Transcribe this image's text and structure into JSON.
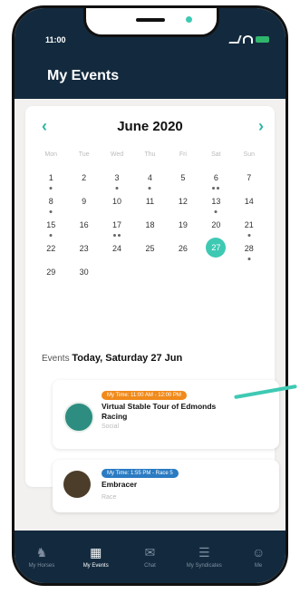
{
  "status": {
    "time": "11:00"
  },
  "header": {
    "title": "My Events"
  },
  "calendar": {
    "month": "June 2020",
    "weekdays": [
      "Mon",
      "Tue",
      "Wed",
      "Thu",
      "Fri",
      "Sat",
      "Sun"
    ],
    "days": [
      {
        "n": "1",
        "dots": 1
      },
      {
        "n": "2",
        "dots": 0
      },
      {
        "n": "3",
        "dots": 1
      },
      {
        "n": "4",
        "dots": 1
      },
      {
        "n": "5",
        "dots": 0
      },
      {
        "n": "6",
        "dots": 2
      },
      {
        "n": "7",
        "dots": 0
      },
      {
        "n": "8",
        "dots": 1
      },
      {
        "n": "9",
        "dots": 0
      },
      {
        "n": "10",
        "dots": 0
      },
      {
        "n": "11",
        "dots": 0
      },
      {
        "n": "12",
        "dots": 0
      },
      {
        "n": "13",
        "dots": 1
      },
      {
        "n": "14",
        "dots": 0
      },
      {
        "n": "15",
        "dots": 1
      },
      {
        "n": "16",
        "dots": 0
      },
      {
        "n": "17",
        "dots": 2
      },
      {
        "n": "18",
        "dots": 0
      },
      {
        "n": "19",
        "dots": 0
      },
      {
        "n": "20",
        "dots": 0
      },
      {
        "n": "21",
        "dots": 1
      },
      {
        "n": "22",
        "dots": 0
      },
      {
        "n": "23",
        "dots": 0
      },
      {
        "n": "24",
        "dots": 0
      },
      {
        "n": "25",
        "dots": 0
      },
      {
        "n": "26",
        "dots": 0
      },
      {
        "n": "27",
        "dots": 0,
        "selected": true
      },
      {
        "n": "28",
        "dots": 1
      },
      {
        "n": "29",
        "dots": 0
      },
      {
        "n": "30",
        "dots": 0
      }
    ]
  },
  "events": {
    "heading_prefix": "Events",
    "heading_date": "Today, Saturday 27 Jun",
    "items": [
      {
        "badge": "My Time: 11:00 AM - 12:00 PM",
        "name": "Virtual Stable Tour of Edmonds Racing",
        "sub": "Social",
        "badge_color": "#f08a1b",
        "icon": "tooth-logo"
      },
      {
        "badge": "My Time: 1:55 PM - Race 5",
        "name": "Embracer",
        "sub": "Race",
        "badge_color": "#2a7bc2",
        "icon": "horse-photo"
      }
    ]
  },
  "tabs": [
    {
      "label": "My Horses",
      "icon": "horse-icon"
    },
    {
      "label": "My Events",
      "icon": "calendar-icon",
      "active": true
    },
    {
      "label": "Chat",
      "icon": "chat-icon"
    },
    {
      "label": "My Syndicates",
      "icon": "group-icon"
    },
    {
      "label": "Me",
      "icon": "person-icon"
    }
  ]
}
